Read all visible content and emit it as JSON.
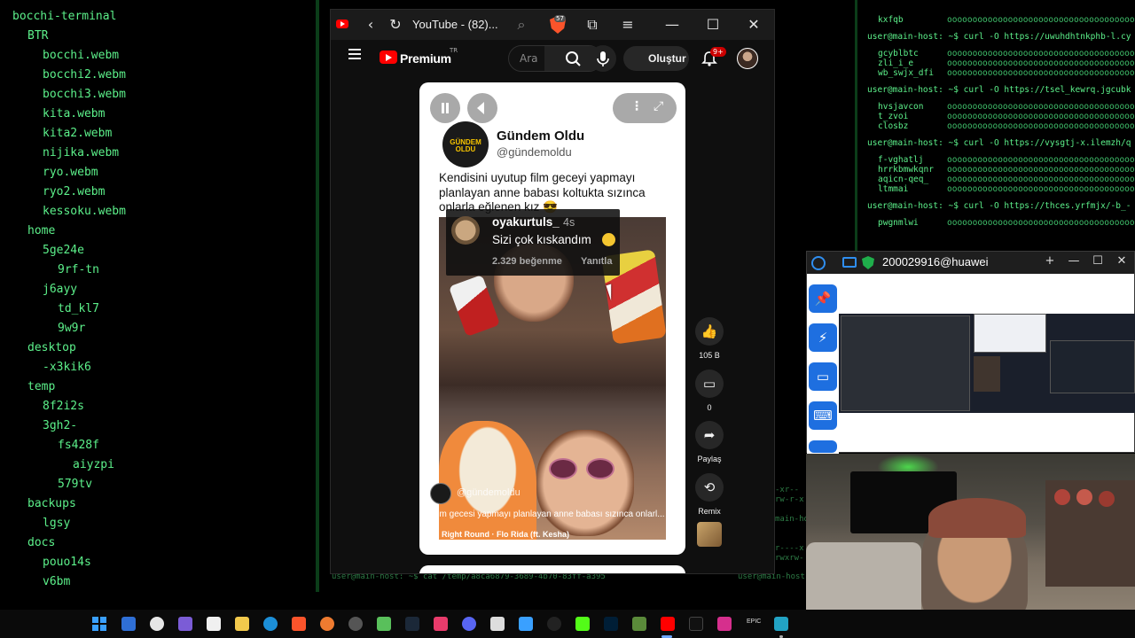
{
  "tree": {
    "lines": [
      {
        "text": "bocchi-terminal",
        "indent": 0
      },
      {
        "text": "BTR",
        "indent": 1
      },
      {
        "text": "bocchi.webm",
        "indent": 2
      },
      {
        "text": "bocchi2.webm",
        "indent": 2
      },
      {
        "text": "bocchi3.webm",
        "indent": 2
      },
      {
        "text": "kita.webm",
        "indent": 2
      },
      {
        "text": "kita2.webm",
        "indent": 2
      },
      {
        "text": "nijika.webm",
        "indent": 2
      },
      {
        "text": "ryo.webm",
        "indent": 2
      },
      {
        "text": "ryo2.webm",
        "indent": 2
      },
      {
        "text": "kessoku.webm",
        "indent": 2
      },
      {
        "text": "home",
        "indent": 1
      },
      {
        "text": "5ge24e",
        "indent": 2
      },
      {
        "text": "9rf-tn",
        "indent": 3
      },
      {
        "text": "j6ayy",
        "indent": 2
      },
      {
        "text": "td_kl7",
        "indent": 3
      },
      {
        "text": "9w9r",
        "indent": 3
      },
      {
        "text": "desktop",
        "indent": 1
      },
      {
        "text": "-x3kik6",
        "indent": 2
      },
      {
        "text": "temp",
        "indent": 1
      },
      {
        "text": "8f2i2s",
        "indent": 2
      },
      {
        "text": "3gh2-",
        "indent": 2
      },
      {
        "text": "fs428f",
        "indent": 3
      },
      {
        "text": "aiyzpi",
        "indent": 4
      },
      {
        "text": "579tv",
        "indent": 3
      },
      {
        "text": "backups",
        "indent": 1
      },
      {
        "text": "lgsy",
        "indent": 2
      },
      {
        "text": "docs",
        "indent": 1
      },
      {
        "text": "pouo14s",
        "indent": 2
      },
      {
        "text": "v6bm",
        "indent": 2
      }
    ]
  },
  "right_terminal": {
    "lines": [
      {
        "type": "file",
        "name": "kxfqb"
      },
      {
        "type": "prompt",
        "text": "user@main-host: ~$ curl -O https://uwuhdhtnkphb-l.cy"
      },
      {
        "type": "file",
        "name": "gcyblbtc"
      },
      {
        "type": "file",
        "name": "zli_i_e"
      },
      {
        "type": "file",
        "name": "wb_swjx_dfi"
      },
      {
        "type": "prompt",
        "text": "user@main-host: ~$ curl -O https://tsel_kewrq.jgcubk"
      },
      {
        "type": "file",
        "name": "hvsjavcon"
      },
      {
        "type": "file",
        "name": "t_zvoi"
      },
      {
        "type": "file",
        "name": "closbz"
      },
      {
        "type": "prompt",
        "text": "user@main-host: ~$ curl -O https://vysgtj-x.ilemzh/q"
      },
      {
        "type": "file",
        "name": "f-vghatlj"
      },
      {
        "type": "file",
        "name": "hrrkbmwkqnr"
      },
      {
        "type": "file",
        "name": "aqicn-qeq_"
      },
      {
        "type": "file",
        "name": "ltmmai"
      },
      {
        "type": "prompt",
        "text": "user@main-host: ~$ curl -O https://thces.yrfmjx/-b_-"
      },
      {
        "type": "file",
        "name": "pwgnmlwi"
      }
    ],
    "zeros": "oooooooooooooooooooooooooooooooooooooo"
  },
  "bottom_strip": {
    "left_prompt": "user@main-host: ~$ cat /temp/a8ca6879-3689-4b70-83ff-a395",
    "right_prompt": "user@main-host",
    "perm1": "-xr--",
    "perm2": "rw-r-x",
    "host1": "main-host",
    "perm3": "r----x",
    "perm4": "rwxrw-"
  },
  "browser": {
    "tab_title": "YouTube - (82)...",
    "brave_count": "57",
    "controls": {
      "minimize": "—",
      "maximize": "☐",
      "close": "✕"
    },
    "header": {
      "logo_text": "Premium",
      "logo_region": "TR",
      "search_placeholder": "Ara",
      "create_label": "Oluştur",
      "bell_badge": "9+"
    },
    "short": {
      "post_logo_text": "GÜNDEM OLDU",
      "post_name": "Gündem Oldu",
      "post_handle": "@gündemoldu",
      "post_text": "Kendisini uyutup film geceyi yapmayı planlayan anne babası koltukta sızınca onlarla eğlenen kız 😎",
      "comment_user": "oyakurtuls_",
      "comment_time": "4s",
      "comment_text": "Sizi çok kıskandım",
      "comment_likes": "2.329 beğenme",
      "comment_reply": "Yanıtla",
      "channel": "@gündemoldu",
      "caption": "Film gecesi yapmayı planlayan anne babası sızınca onlarl...",
      "music": "♪ Right Round · Flo Rida (ft. Kesha)"
    },
    "actions": {
      "like_count": "105 B",
      "comment_count": "0",
      "share_label": "Paylaş",
      "remix_label": "Remix"
    }
  },
  "remote_desktop": {
    "title": "200029916@huawei",
    "controls": {
      "add": "+",
      "minimize": "—",
      "maximize": "☐",
      "close": "✕"
    }
  },
  "taskbar": {
    "tray_text": "EPIC"
  },
  "colors": {
    "terminal_green": "#5cf08a",
    "youtube_red": "#ff0000",
    "remote_blue": "#1e6fe0"
  }
}
